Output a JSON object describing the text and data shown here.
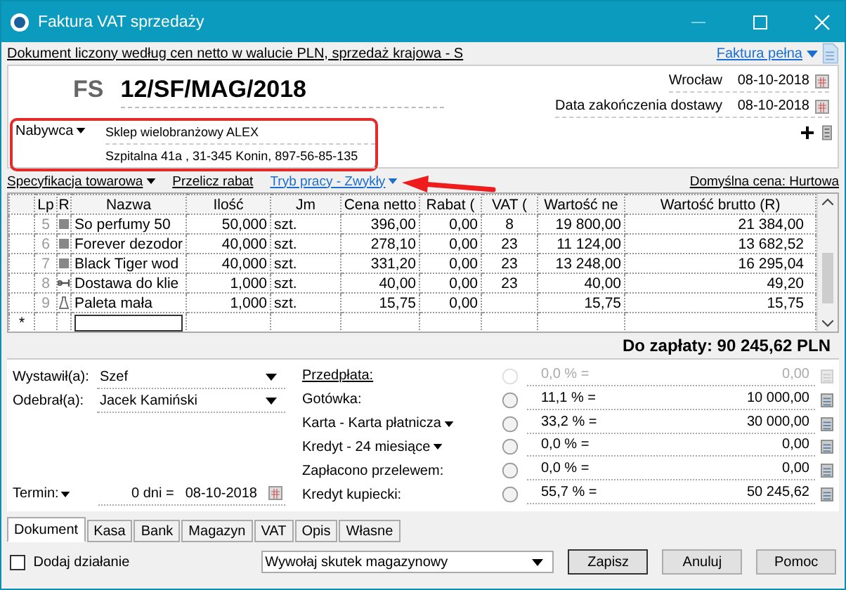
{
  "window": {
    "title": "Faktura VAT sprzedaży"
  },
  "info_bar": {
    "text": "Dokument liczony według cen netto w walucie PLN, sprzedaż krajowa - S",
    "variant": "Faktura pełna"
  },
  "header": {
    "type": "FS",
    "number": "12/SF/MAG/2018",
    "place": "Wrocław",
    "date": "08-10-2018",
    "delivery_label": "Data zakończenia dostawy",
    "delivery_date": "08-10-2018"
  },
  "buyer": {
    "label": "Nabywca",
    "name": "Sklep wielobranżowy  ALEX",
    "address": "Szpitalna  41a , 31-345 Konin, 897-56-85-135",
    "highlighted": true
  },
  "links": {
    "spec": "Specyfikacja towarowa",
    "recalc": "Przelicz rabat",
    "mode": "Tryb pracy - Zwykły",
    "default_price": "Domyślna cena: Hurtowa"
  },
  "table": {
    "columns": [
      "Lp",
      "R",
      "Nazwa",
      "Ilość",
      "Jm",
      "Cena netto",
      "Rabat (",
      "VAT (",
      "Wartość ne",
      "Wartość brutto (R)"
    ],
    "rows": [
      {
        "lp": "5",
        "kind": "towar",
        "name": "So perfumy 50",
        "qty": "50,000",
        "unit": "szt.",
        "price": "396,00",
        "discount": "0,00",
        "vat": "8",
        "net": "19 800,00",
        "gross": "21 384,00"
      },
      {
        "lp": "6",
        "kind": "towar",
        "name": "Forever dezodor",
        "qty": "40,000",
        "unit": "szt.",
        "price": "278,10",
        "discount": "0,00",
        "vat": "23",
        "net": "11 124,00",
        "gross": "13 682,52"
      },
      {
        "lp": "7",
        "kind": "towar",
        "name": "Black Tiger wod",
        "qty": "40,000",
        "unit": "szt.",
        "price": "331,20",
        "discount": "0,00",
        "vat": "23",
        "net": "13 248,00",
        "gross": "16 295,04"
      },
      {
        "lp": "8",
        "kind": "usluga",
        "name": "Dostawa do klie",
        "qty": "1,000",
        "unit": "szt.",
        "price": "40,00",
        "discount": "0,00",
        "vat": "23",
        "net": "40,00",
        "gross": "49,20"
      },
      {
        "lp": "9",
        "kind": "opakowanie",
        "name": "Paleta mała",
        "qty": "1,000",
        "unit": "szt.",
        "price": "15,75",
        "discount": "0,00",
        "net": "15,75",
        "gross": "15,75"
      }
    ],
    "new_row_mark": "*"
  },
  "total": "Do zapłaty: 90 245,62 PLN",
  "people": [
    {
      "label": "Wystawił(a):",
      "value": "Szef"
    },
    {
      "label": "Odebrał(a):",
      "value": "Jacek Kamiński"
    }
  ],
  "term": {
    "label": "Termin:",
    "days": "0 dni =",
    "date": "08-10-2018"
  },
  "payments": [
    {
      "label": "Przedpłata:",
      "kind": "link",
      "disabled": true,
      "percent": "0,0 % =",
      "amount": "0,00"
    },
    {
      "label": "Gotówka:",
      "kind": "plain",
      "disabled": false,
      "percent": "11,1 % =",
      "amount": "10 000,00"
    },
    {
      "label": "Karta - Karta płatnicza",
      "kind": "dropdown",
      "disabled": false,
      "percent": "33,2 % =",
      "amount": "30 000,00"
    },
    {
      "label": "Kredyt - 24 miesiące",
      "kind": "dropdown",
      "disabled": false,
      "percent": "0,0 % =",
      "amount": "0,00"
    },
    {
      "label": "Zapłacono przelewem:",
      "kind": "plain",
      "disabled": false,
      "percent": "0,0 % =",
      "amount": "0,00"
    },
    {
      "label": "Kredyt kupiecki:",
      "kind": "plain",
      "disabled": false,
      "percent": "55,7 % =",
      "amount": "50 245,62"
    }
  ],
  "tabs": [
    {
      "label": "Dokument",
      "selected": true
    },
    {
      "label": "Kasa",
      "selected": false
    },
    {
      "label": "Bank",
      "selected": false
    },
    {
      "label": "Magazyn",
      "selected": false
    },
    {
      "label": "VAT",
      "selected": false
    },
    {
      "label": "Opis",
      "selected": false
    },
    {
      "label": "Własne",
      "selected": false
    }
  ],
  "footer": {
    "add_action": {
      "label": "Dodaj działanie",
      "checked": false
    },
    "action": "Wywołaj skutek magazynowy",
    "buttons": [
      "Zapisz",
      "Anuluj",
      "Pomoc"
    ]
  }
}
